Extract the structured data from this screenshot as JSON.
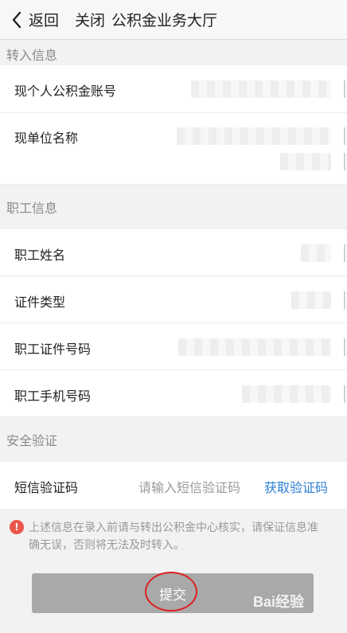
{
  "header": {
    "back_label": "返回",
    "close_label": "关闭",
    "title": "公积金业务大厅"
  },
  "section_transfer": {
    "title": "转入信息"
  },
  "transfer_rows": [
    {
      "label": "现个人公积金账号"
    },
    {
      "label": "现单位名称"
    }
  ],
  "section_employee": {
    "title": "职工信息"
  },
  "employee_rows": [
    {
      "label": "职工姓名"
    },
    {
      "label": "证件类型"
    },
    {
      "label": "职工证件号码"
    },
    {
      "label": "职工手机号码"
    }
  ],
  "section_security": {
    "title": "安全验证"
  },
  "sms": {
    "label": "短信验证码",
    "placeholder": "请输入短信验证码",
    "get_code_label": "获取验证码"
  },
  "notice": {
    "icon": "!",
    "text": "上述信息在录入前请与转出公积金中心核实，请保证信息准确无误，否则将无法及时转入。"
  },
  "submit_label": "提交",
  "watermark": "Bai经验",
  "colors": {
    "link": "#2a7fd4",
    "warning": "#e9574a",
    "button_disabled": "#a9a9a9"
  }
}
